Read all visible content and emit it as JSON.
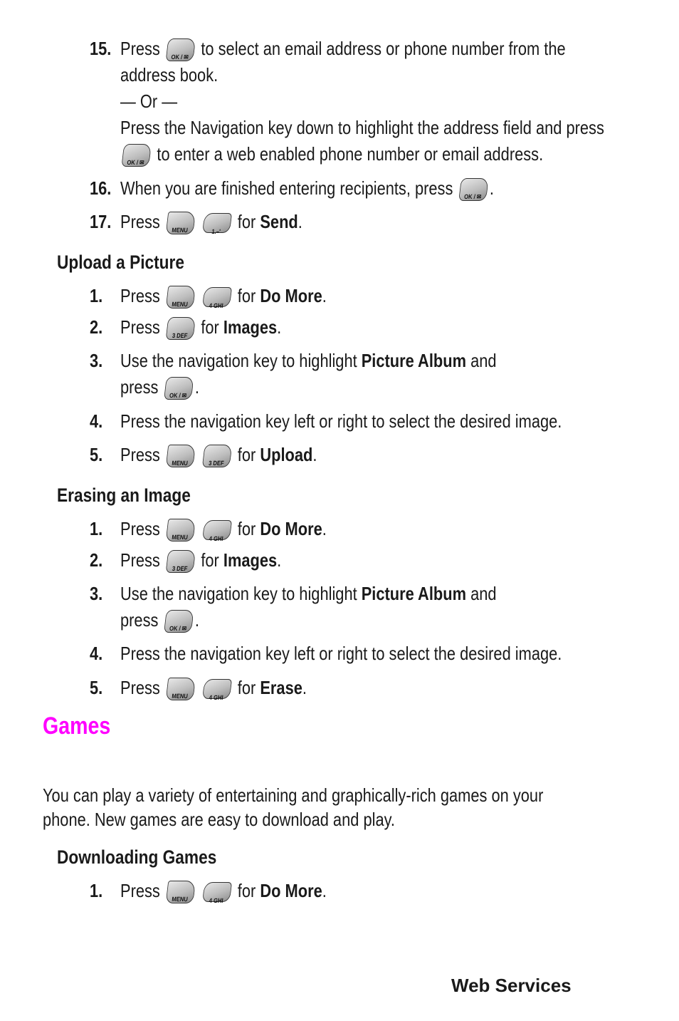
{
  "steps_top": [
    {
      "num": "15.",
      "lines": [
        {
          "pre": "Press",
          "keys": [
            "ok"
          ],
          "post": "to select an email address or phone number from the"
        },
        {
          "text": "address book."
        },
        {
          "text": "— Or —"
        },
        {
          "text": "Press the Navigation key down to highlight the address field and press"
        },
        {
          "keys_first": [
            "ok"
          ],
          "post": "to enter a web enabled phone number or email address."
        }
      ]
    },
    {
      "num": "16.",
      "pre": "When you are finished entering recipients, press",
      "keys": [
        "ok"
      ],
      "post": "."
    },
    {
      "num": "17.",
      "pre": "Press",
      "keys": [
        "menu",
        "1"
      ],
      "post_pre": "for",
      "bold": "Send",
      "post": "."
    }
  ],
  "keys": {
    "ok": "OK / ✉",
    "menu": "MENU",
    "1": "1.–'",
    "3": "3 DEF",
    "4": "4 GHI"
  },
  "upload": {
    "heading": "Upload a Picture",
    "steps": [
      {
        "num": "1.",
        "pre": "Press",
        "keys": [
          "menu",
          "4"
        ],
        "for": "for",
        "bold": "Do More",
        "post": "."
      },
      {
        "num": "2.",
        "pre": "Press",
        "keys": [
          "3"
        ],
        "for": "for",
        "bold": "Images",
        "post": "."
      },
      {
        "num": "3.",
        "pre": "Use the navigation key to highlight",
        "bold": "Picture Album",
        "post": "and",
        "line2_pre": "press",
        "line2_keys": [
          "ok"
        ],
        "line2_post": "."
      },
      {
        "num": "4.",
        "text": "Press the navigation key left or right to select the desired image."
      },
      {
        "num": "5.",
        "pre": "Press",
        "keys": [
          "menu",
          "3"
        ],
        "for": "for",
        "bold": "Upload",
        "post": "."
      }
    ]
  },
  "erase": {
    "heading": "Erasing an Image",
    "steps": [
      {
        "num": "1.",
        "pre": "Press",
        "keys": [
          "menu",
          "4"
        ],
        "for": "for",
        "bold": "Do More",
        "post": "."
      },
      {
        "num": "2.",
        "pre": "Press",
        "keys": [
          "3"
        ],
        "for": "for",
        "bold": "Images",
        "post": "."
      },
      {
        "num": "3.",
        "pre": "Use the navigation key to highlight",
        "bold": "Picture Album",
        "post": "and",
        "line2_pre": "press",
        "line2_keys": [
          "ok"
        ],
        "line2_post": "."
      },
      {
        "num": "4.",
        "text": "Press the navigation key left or right to select the desired image."
      },
      {
        "num": "5.",
        "pre": "Press",
        "keys": [
          "menu",
          "4"
        ],
        "for": "for",
        "bold": "Erase",
        "post": "."
      }
    ]
  },
  "games": {
    "heading": "Games",
    "color": "#ff00ff",
    "para_line1": "You can play a variety of entertaining and graphically-rich games on your",
    "para_line2": "phone. New games are easy to download and play.",
    "download": {
      "heading": "Downloading Games",
      "steps": [
        {
          "num": "1.",
          "pre": "Press",
          "keys": [
            "menu",
            "4"
          ],
          "for": "for",
          "bold": "Do More",
          "post": "."
        }
      ]
    }
  },
  "footer": "Web Services"
}
